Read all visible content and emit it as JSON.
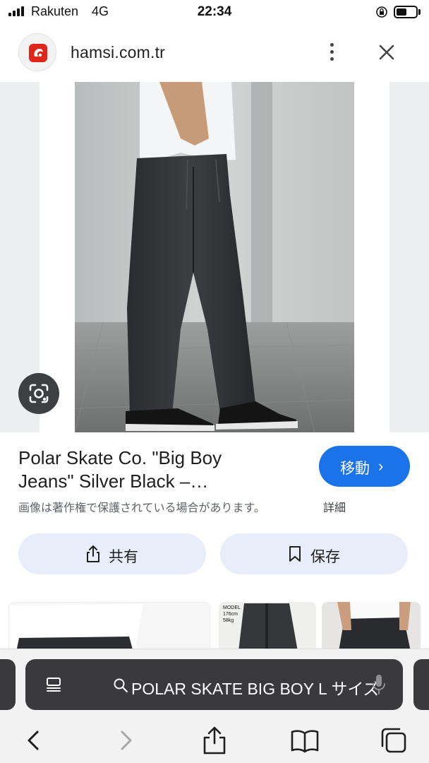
{
  "status_bar": {
    "carrier": "Rakuten",
    "network": "4G",
    "time": "22:34"
  },
  "header": {
    "domain": "hamsi.com.tr",
    "favicon_color": "#e0251b"
  },
  "image": {
    "accent": "#eceeef",
    "lens_icon": "google-lens-icon"
  },
  "result": {
    "title_line1": "Polar Skate Co. \"Big Boy",
    "title_line2": "Jeans\" Silver Black –…",
    "visit_label": "移動",
    "visit_chevron": "›",
    "visit_color": "#1a73e8",
    "copyright_notice": "画像は著作権で保護されている場合があります。",
    "details_label": "詳細"
  },
  "actions": {
    "share_label": "共有",
    "save_label": "保存"
  },
  "related": {
    "thumb_text": "MODEL\n176cm\n58kg"
  },
  "browser": {
    "url_query": "POLAR SKATE BIG BOY L サイズ",
    "url_bar_color": "#3a3a3c"
  }
}
